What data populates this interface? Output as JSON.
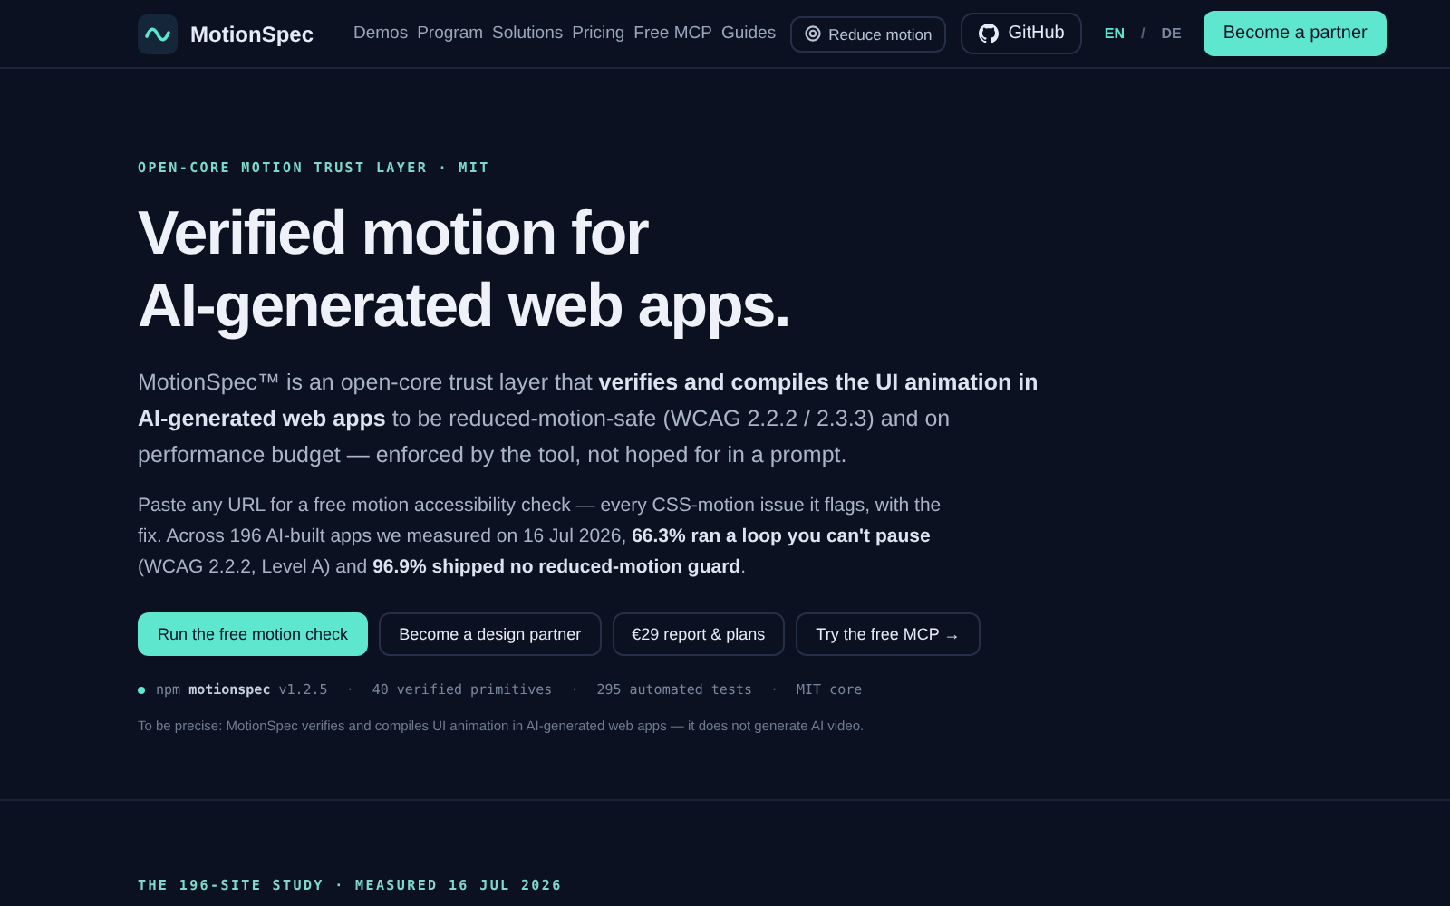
{
  "nav": {
    "brand": "MotionSpec",
    "links": [
      "Demos",
      "Program",
      "Solutions",
      "Pricing",
      "Free MCP",
      "Guides"
    ],
    "reduce_motion": {
      "label": "Reduce motion",
      "on": false
    },
    "github": "GitHub",
    "languages": [
      {
        "label": "EN",
        "selected": true
      },
      {
        "label": "DE",
        "selected": false
      }
    ],
    "language_separator": "/",
    "cta": "Become a partner"
  },
  "hero": {
    "eyebrow": "OPEN-CORE MOTION TRUST LAYER · MIT",
    "headline": [
      "Verified motion for",
      "AI-generated web apps."
    ],
    "lead": "MotionSpec™ is an open-core trust layer that **verifies and compiles the UI animation in AI-generated web apps** to be reduced-motion-safe (WCAG 2.2.2 / 2.3.3) and on performance budget — enforced by the tool, not hoped for in a prompt.",
    "body": "Paste any URL for a free motion accessibility check — every CSS-motion issue it flags, with the fix. Across 196 AI-built apps we measured on 16 Jul 2026, **66.3% ran a loop you can't pause** (WCAG 2.2.2, Level A) and **96.9% shipped no reduced-motion guard**.",
    "buttons": [
      {
        "label": "Run the free motion check",
        "kind": "primary"
      },
      {
        "label": "Become a design partner",
        "kind": "outline"
      },
      {
        "label": "€29 report & plans",
        "kind": "outline"
      },
      {
        "label": "Try the free MCP →",
        "kind": "outline"
      }
    ],
    "meta": [
      "npm **motionspec** v1.2.5",
      "40 verified primitives",
      "295 automated tests",
      "MIT core"
    ],
    "meta_separator": "·",
    "note": "To be precise: MotionSpec verifies and compiles UI animation in AI-generated web apps — it does not generate AI video."
  },
  "next_section": {
    "eyebrow": "THE 196-SITE STUDY · MEASURED 16 JUL 2026"
  }
}
